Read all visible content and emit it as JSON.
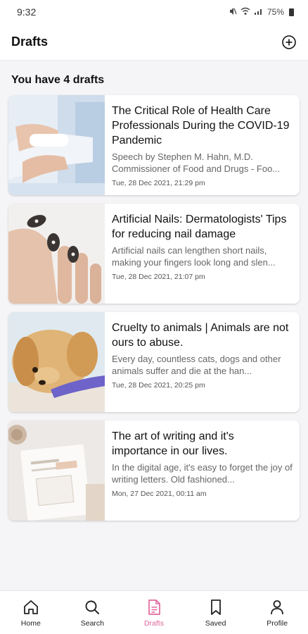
{
  "status": {
    "time": "9:32",
    "battery": "75%"
  },
  "header": {
    "title": "Drafts"
  },
  "summary": "You have 4 drafts",
  "drafts": [
    {
      "title": "The Critical Role of Health Care Professionals During the COVID-19 Pandemic",
      "excerpt": "Speech by Stephen M. Hahn, M.D. Commissioner of Food and Drugs - Foo...",
      "date": "Tue, 28 Dec 2021,  21:29 pm"
    },
    {
      "title": "Artificial Nails: Dermatologists' Tips for reducing nail damage",
      "excerpt": "Artificial nails can lengthen short nails, making your fingers look long and slen...",
      "date": "Tue, 28 Dec 2021,  21:07 pm"
    },
    {
      "title": "Cruelty to animals | Animals are not ours to abuse.",
      "excerpt": "Every day, countless cats, dogs and other animals suffer and die at the han...",
      "date": "Tue, 28 Dec 2021,  20:25 pm"
    },
    {
      "title": "The art of writing and it's importance in our lives.",
      "excerpt": "In the digital age, it's easy to forget the joy of writing letters. Old fashioned...",
      "date": "Mon, 27 Dec 2021,  00:11 am"
    }
  ],
  "nav": [
    {
      "label": "Home",
      "icon": "home-icon"
    },
    {
      "label": "Search",
      "icon": "search-icon"
    },
    {
      "label": "Drafts",
      "icon": "drafts-icon",
      "active": true
    },
    {
      "label": "Saved",
      "icon": "bookmark-icon"
    },
    {
      "label": "Profile",
      "icon": "profile-icon"
    }
  ],
  "colors": {
    "accent": "#e0679c",
    "background": "#f5f5f7",
    "card": "#ffffff"
  }
}
